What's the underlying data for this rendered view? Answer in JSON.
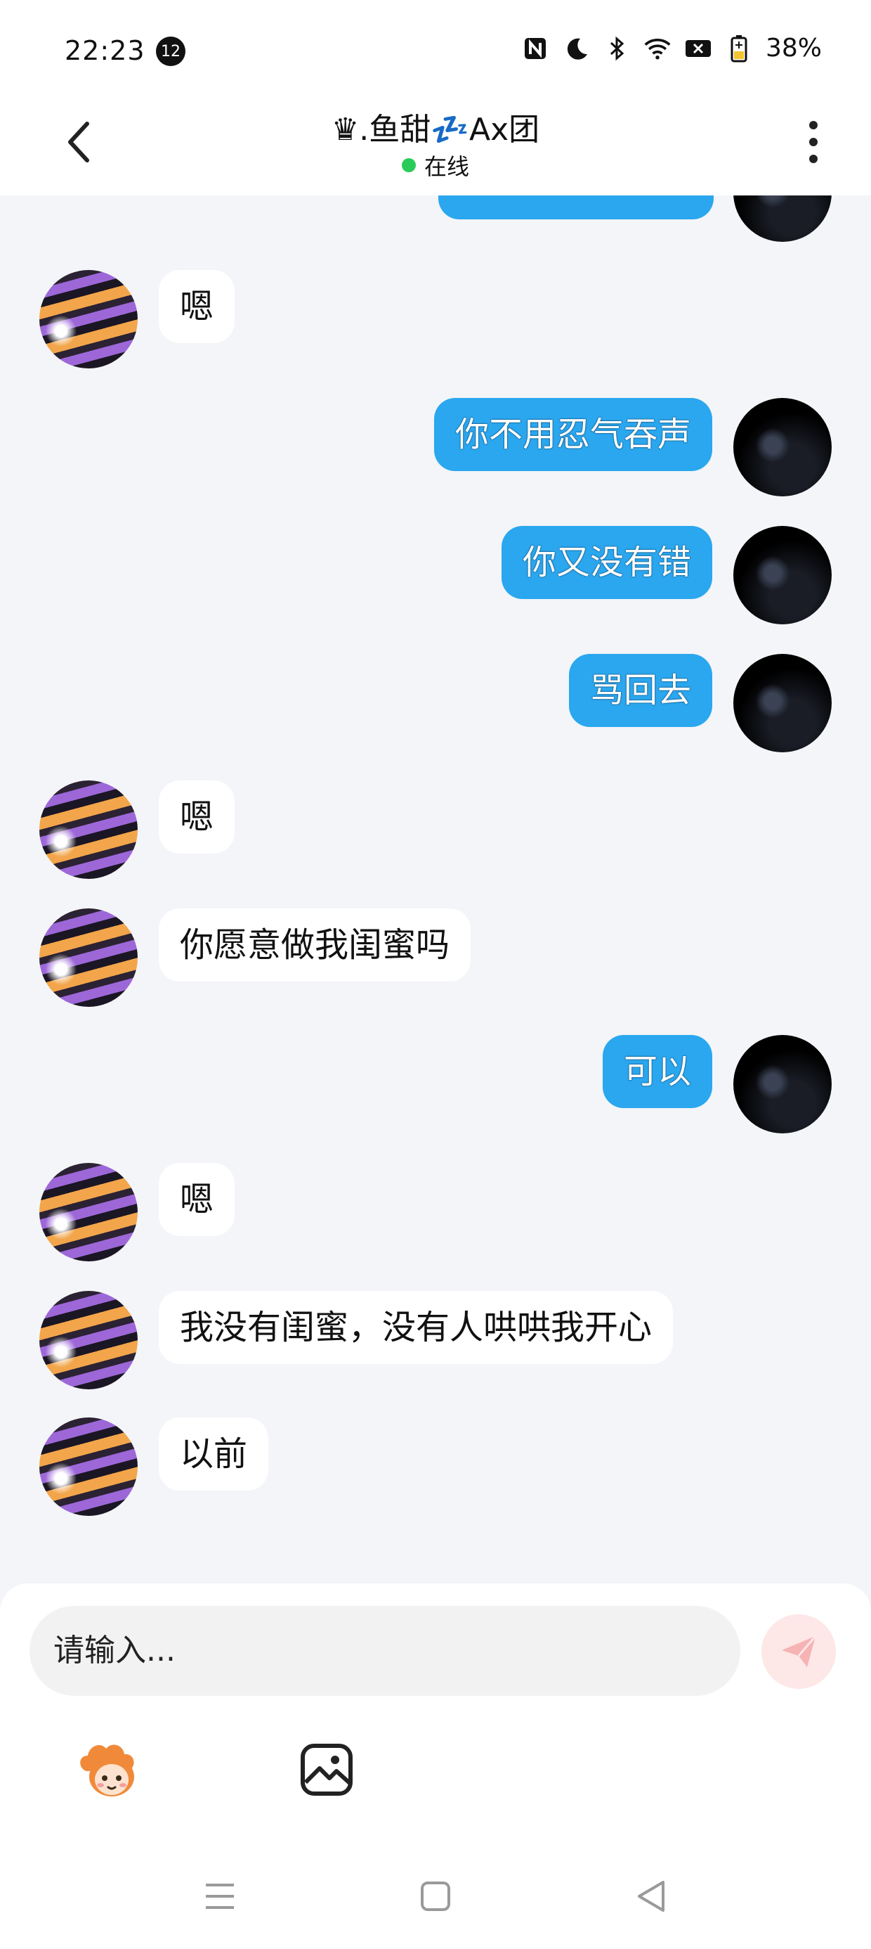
{
  "status_bar": {
    "time": "22:23",
    "notification_count": "12",
    "battery": "38%"
  },
  "header": {
    "title": "♛.鱼甜💤Ax团",
    "status": "在线"
  },
  "messages": [
    {
      "sender": "other",
      "text": "嗯"
    },
    {
      "sender": "self",
      "text": "你不用忍气吞声"
    },
    {
      "sender": "self",
      "text": "你又没有错"
    },
    {
      "sender": "self",
      "text": "骂回去"
    },
    {
      "sender": "other",
      "text": "嗯"
    },
    {
      "sender": "other",
      "text": "你愿意做我闺蜜吗"
    },
    {
      "sender": "self",
      "text": "可以"
    },
    {
      "sender": "other",
      "text": "嗯"
    },
    {
      "sender": "other",
      "text": "我没有闺蜜，没有人哄哄我开心"
    },
    {
      "sender": "other",
      "text": "以前"
    }
  ],
  "composer": {
    "placeholder": "请输入..."
  },
  "icons": {
    "send": "send-icon",
    "emoji": "mascot-emoji-icon",
    "image": "image-icon"
  },
  "colors": {
    "self_bubble": "#2aa7ef",
    "other_bubble": "#ffffff",
    "online": "#2bcb5a",
    "send_disabled": "#fde7e7"
  }
}
